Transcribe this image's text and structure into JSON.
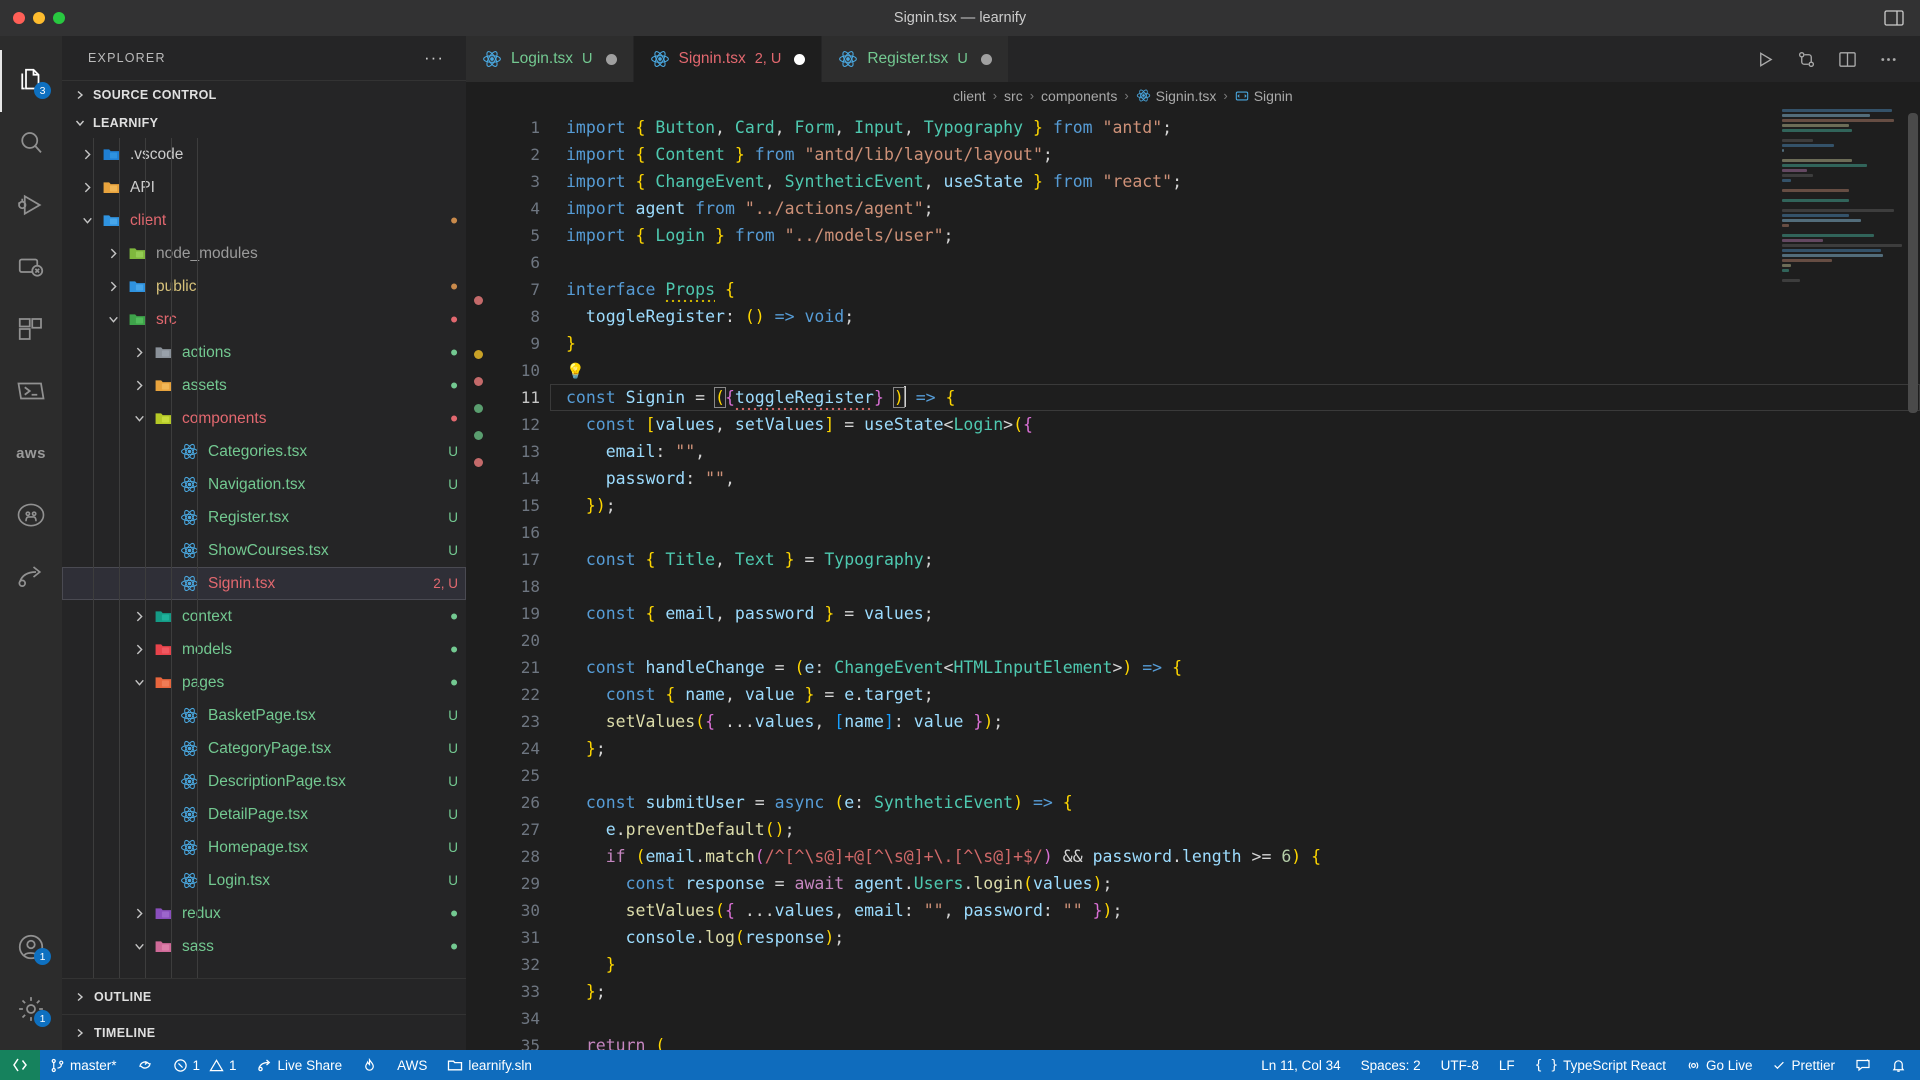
{
  "window": {
    "title": "Signin.tsx — learnify",
    "traffic_lights": [
      "close",
      "minimize",
      "zoom"
    ],
    "layout_icon": "editor-layout-icon"
  },
  "activity_bar": {
    "items": [
      {
        "name": "explorer",
        "icon": "files-icon",
        "badge": "3",
        "active": true
      },
      {
        "name": "search",
        "icon": "search-icon",
        "badge": "",
        "active": false
      },
      {
        "name": "run-and-debug",
        "icon": "debug-icon",
        "badge": "",
        "active": false
      },
      {
        "name": "remote-explorer",
        "icon": "remote-icon",
        "badge": "",
        "active": false
      },
      {
        "name": "extensions",
        "icon": "extensions-icon",
        "badge": "",
        "active": false
      },
      {
        "name": "terminal",
        "icon": "terminal-icon",
        "badge": "",
        "active": false
      },
      {
        "name": "aws-toolkit",
        "icon": "aws-icon",
        "label": "aws",
        "badge": "",
        "active": false
      },
      {
        "name": "github",
        "icon": "github-icon",
        "badge": "",
        "active": false
      },
      {
        "name": "live-share",
        "icon": "live-share-icon",
        "badge": "",
        "active": false
      }
    ],
    "bottom_items": [
      {
        "name": "accounts",
        "icon": "account-icon",
        "badge": "1"
      },
      {
        "name": "settings",
        "icon": "gear-icon",
        "badge": "1"
      }
    ]
  },
  "sidebar": {
    "header": {
      "title": "EXPLORER",
      "more_actions": "···"
    },
    "source_control_panel": {
      "label": "SOURCE CONTROL",
      "chevron": "chevron-right-icon"
    },
    "project": {
      "label": "LEARNIFY",
      "chevron": "chevron-down-icon"
    },
    "tree": [
      {
        "label": ".vscode",
        "indent": 1,
        "type": "folder",
        "state": "collapsed",
        "icon": "folder-vscode-icon",
        "color": "#cccccc",
        "suffix": "",
        "selected": false
      },
      {
        "label": "API",
        "indent": 1,
        "type": "folder",
        "state": "collapsed",
        "icon": "folder-api-icon",
        "color": "#cccccc",
        "suffix": "",
        "selected": false
      },
      {
        "label": "client",
        "indent": 1,
        "type": "folder",
        "state": "expanded",
        "icon": "folder-client-icon",
        "color": "#e2686f",
        "suffix": "",
        "selected": false,
        "dot": "#c98a4b"
      },
      {
        "label": "node_modules",
        "indent": 2,
        "type": "folder",
        "state": "collapsed",
        "icon": "folder-node-icon",
        "color": "#9b9b9b",
        "suffix": "",
        "selected": false
      },
      {
        "label": "public",
        "indent": 2,
        "type": "folder",
        "state": "collapsed",
        "icon": "folder-public-icon",
        "color": "#d6c17a",
        "suffix": "",
        "selected": false,
        "dot": "#c98a4b"
      },
      {
        "label": "src",
        "indent": 2,
        "type": "folder",
        "state": "expanded",
        "icon": "folder-src-icon",
        "color": "#e2686f",
        "suffix": "",
        "selected": false,
        "dot": "#e2686f"
      },
      {
        "label": "actions",
        "indent": 3,
        "type": "folder",
        "state": "collapsed",
        "icon": "folder-generic-icon",
        "color": "#73c991",
        "suffix": "",
        "selected": false,
        "dot": "#73c991"
      },
      {
        "label": "assets",
        "indent": 3,
        "type": "folder",
        "state": "collapsed",
        "icon": "folder-assets-icon",
        "color": "#73c991",
        "suffix": "",
        "selected": false,
        "dot": "#73c991"
      },
      {
        "label": "components",
        "indent": 3,
        "type": "folder",
        "state": "expanded",
        "icon": "folder-components-icon",
        "color": "#e2686f",
        "suffix": "",
        "selected": false,
        "dot": "#e2686f"
      },
      {
        "label": "Categories.tsx",
        "indent": 4,
        "type": "file",
        "state": "",
        "icon": "react-icon",
        "color": "#73c991",
        "suffix": "U",
        "selected": false
      },
      {
        "label": "Navigation.tsx",
        "indent": 4,
        "type": "file",
        "state": "",
        "icon": "react-icon",
        "color": "#73c991",
        "suffix": "U",
        "selected": false
      },
      {
        "label": "Register.tsx",
        "indent": 4,
        "type": "file",
        "state": "",
        "icon": "react-icon",
        "color": "#73c991",
        "suffix": "U",
        "selected": false
      },
      {
        "label": "ShowCourses.tsx",
        "indent": 4,
        "type": "file",
        "state": "",
        "icon": "react-icon",
        "color": "#73c991",
        "suffix": "U",
        "selected": false
      },
      {
        "label": "Signin.tsx",
        "indent": 4,
        "type": "file",
        "state": "",
        "icon": "react-icon",
        "color": "#e2686f",
        "suffix": "2, U",
        "selected": true
      },
      {
        "label": "context",
        "indent": 3,
        "type": "folder",
        "state": "collapsed",
        "icon": "folder-context-icon",
        "color": "#73c991",
        "suffix": "",
        "selected": false,
        "dot": "#73c991"
      },
      {
        "label": "models",
        "indent": 3,
        "type": "folder",
        "state": "collapsed",
        "icon": "folder-models-icon",
        "color": "#73c991",
        "suffix": "",
        "selected": false,
        "dot": "#73c991"
      },
      {
        "label": "pages",
        "indent": 3,
        "type": "folder",
        "state": "expanded",
        "icon": "folder-pages-icon",
        "color": "#73c991",
        "suffix": "",
        "selected": false,
        "dot": "#73c991"
      },
      {
        "label": "BasketPage.tsx",
        "indent": 4,
        "type": "file",
        "state": "",
        "icon": "react-icon",
        "color": "#73c991",
        "suffix": "U",
        "selected": false
      },
      {
        "label": "CategoryPage.tsx",
        "indent": 4,
        "type": "file",
        "state": "",
        "icon": "react-icon",
        "color": "#73c991",
        "suffix": "U",
        "selected": false
      },
      {
        "label": "DescriptionPage.tsx",
        "indent": 4,
        "type": "file",
        "state": "",
        "icon": "react-icon",
        "color": "#73c991",
        "suffix": "U",
        "selected": false
      },
      {
        "label": "DetailPage.tsx",
        "indent": 4,
        "type": "file",
        "state": "",
        "icon": "react-icon",
        "color": "#73c991",
        "suffix": "U",
        "selected": false
      },
      {
        "label": "Homepage.tsx",
        "indent": 4,
        "type": "file",
        "state": "",
        "icon": "react-icon",
        "color": "#73c991",
        "suffix": "U",
        "selected": false
      },
      {
        "label": "Login.tsx",
        "indent": 4,
        "type": "file",
        "state": "",
        "icon": "react-icon",
        "color": "#73c991",
        "suffix": "U",
        "selected": false
      },
      {
        "label": "redux",
        "indent": 3,
        "type": "folder",
        "state": "collapsed",
        "icon": "folder-redux-icon",
        "color": "#73c991",
        "suffix": "",
        "selected": false,
        "dot": "#73c991"
      },
      {
        "label": "sass",
        "indent": 3,
        "type": "folder",
        "state": "expanded",
        "icon": "folder-sass-icon",
        "color": "#73c991",
        "suffix": "",
        "selected": false,
        "dot": "#73c991"
      }
    ],
    "bottom_panels": [
      {
        "label": "OUTLINE",
        "chevron": "chevron-right-icon"
      },
      {
        "label": "TIMELINE",
        "chevron": "chevron-right-icon"
      }
    ]
  },
  "editor": {
    "tabs": [
      {
        "name": "Login.tsx",
        "icon": "react-icon",
        "badge": "U",
        "badge_color": "#73c991",
        "name_color": "#73c991",
        "dirty": true,
        "active": false
      },
      {
        "name": "Signin.tsx",
        "icon": "react-icon",
        "badge": "2, U",
        "badge_color": "#e2686f",
        "name_color": "#e2686f",
        "dirty": true,
        "active": true
      },
      {
        "name": "Register.tsx",
        "icon": "react-icon",
        "badge": "U",
        "badge_color": "#73c991",
        "name_color": "#73c991",
        "dirty": true,
        "active": false
      }
    ],
    "tab_actions": [
      {
        "name": "run-file",
        "icon": "play-icon"
      },
      {
        "name": "source-control-graph",
        "icon": "git-compare-icon"
      },
      {
        "name": "split-editor",
        "icon": "split-editor-icon"
      },
      {
        "name": "more-actions",
        "icon": "ellipsis-icon"
      }
    ],
    "breadcrumb": [
      {
        "label": "client",
        "icon": ""
      },
      {
        "label": "src",
        "icon": ""
      },
      {
        "label": "components",
        "icon": ""
      },
      {
        "label": "Signin.tsx",
        "icon": "react-icon"
      },
      {
        "label": "Signin",
        "icon": "symbol-variable-icon"
      }
    ],
    "first_line_number": 1,
    "lines": [
      {
        "n": 1,
        "text": "import { Button, Card, Form, Input, Typography } from \"antd\";"
      },
      {
        "n": 2,
        "text": "import { Content } from \"antd/lib/layout/layout\";"
      },
      {
        "n": 3,
        "text": "import { ChangeEvent, SyntheticEvent, useState } from \"react\";"
      },
      {
        "n": 4,
        "text": "import agent from \"../actions/agent\";"
      },
      {
        "n": 5,
        "text": "import { Login } from \"../models/user\";"
      },
      {
        "n": 6,
        "text": ""
      },
      {
        "n": 7,
        "text": "interface Props {"
      },
      {
        "n": 8,
        "text": "  toggleRegister: () => void;"
      },
      {
        "n": 9,
        "text": "}"
      },
      {
        "n": 10,
        "text": ""
      },
      {
        "n": 11,
        "text": "const Signin = ({toggleRegister} ) => {"
      },
      {
        "n": 12,
        "text": "  const [values, setValues] = useState<Login>({"
      },
      {
        "n": 13,
        "text": "    email: \"\","
      },
      {
        "n": 14,
        "text": "    password: \"\","
      },
      {
        "n": 15,
        "text": "  });"
      },
      {
        "n": 16,
        "text": ""
      },
      {
        "n": 17,
        "text": "  const { Title, Text } = Typography;"
      },
      {
        "n": 18,
        "text": ""
      },
      {
        "n": 19,
        "text": "  const { email, password } = values;"
      },
      {
        "n": 20,
        "text": ""
      },
      {
        "n": 21,
        "text": "  const handleChange = (e: ChangeEvent<HTMLInputElement>) => {"
      },
      {
        "n": 22,
        "text": "    const { name, value } = e.target;"
      },
      {
        "n": 23,
        "text": "    setValues({ ...values, [name]: value });"
      },
      {
        "n": 24,
        "text": "  };"
      },
      {
        "n": 25,
        "text": ""
      },
      {
        "n": 26,
        "text": "  const submitUser = async (e: SyntheticEvent) => {"
      },
      {
        "n": 27,
        "text": "    e.preventDefault();"
      },
      {
        "n": 28,
        "text": "    if (email.match(/^[^\\s@]+@[^\\s@]+\\.[^\\s@]+$/) && password.length >= 6) {"
      },
      {
        "n": 29,
        "text": "      const response = await agent.Users.login(values);"
      },
      {
        "n": 30,
        "text": "      setValues({ ...values, email: \"\", password: \"\" });"
      },
      {
        "n": 31,
        "text": "      console.log(response);"
      },
      {
        "n": 32,
        "text": "    }"
      },
      {
        "n": 33,
        "text": "  };"
      },
      {
        "n": 34,
        "text": ""
      },
      {
        "n": 35,
        "text": "  return ("
      }
    ],
    "lightbulb_line": 10,
    "cursor_line": 11
  },
  "status_bar": {
    "remote": {
      "label": "",
      "icon": "remote-window-icon"
    },
    "left": [
      {
        "name": "branch",
        "icon": "git-branch-icon",
        "label": "master*"
      },
      {
        "name": "sync",
        "icon": "sync-icon",
        "label": ""
      },
      {
        "name": "problems",
        "icon": "error-warning-icon",
        "label": "1 ⚠ 1",
        "errors": "1",
        "warnings": "1"
      },
      {
        "name": "live-share",
        "icon": "live-share-icon",
        "label": "Live Share"
      },
      {
        "name": "flame",
        "icon": "flame-icon",
        "label": ""
      },
      {
        "name": "aws",
        "icon": "",
        "label": "AWS"
      },
      {
        "name": "solution",
        "icon": "folder-open-icon",
        "label": "learnify.sln"
      }
    ],
    "right": [
      {
        "name": "cursor-position",
        "icon": "",
        "label": "Ln 11, Col 34"
      },
      {
        "name": "indentation",
        "icon": "",
        "label": "Spaces: 2"
      },
      {
        "name": "encoding",
        "icon": "",
        "label": "UTF-8"
      },
      {
        "name": "eol",
        "icon": "",
        "label": "LF"
      },
      {
        "name": "language-mode",
        "icon": "braces-icon",
        "label": "TypeScript React"
      },
      {
        "name": "go-live",
        "icon": "broadcast-icon",
        "label": "Go Live"
      },
      {
        "name": "prettier",
        "icon": "check-icon",
        "label": "Prettier"
      },
      {
        "name": "remote-feedback",
        "icon": "feedback-icon",
        "label": ""
      },
      {
        "name": "notifications",
        "icon": "bell-icon",
        "label": ""
      }
    ]
  },
  "colors": {
    "accent_blue": "#0f6cbd",
    "remote_green": "#16825d",
    "badge_blue": "#0e70c0",
    "editor_bg": "#1e1e1e",
    "sidebar_bg": "#252526",
    "activity_bg": "#2c2c2c",
    "titlebar_bg": "#323233",
    "modified_red": "#e2686f",
    "untracked_green": "#73c991"
  }
}
